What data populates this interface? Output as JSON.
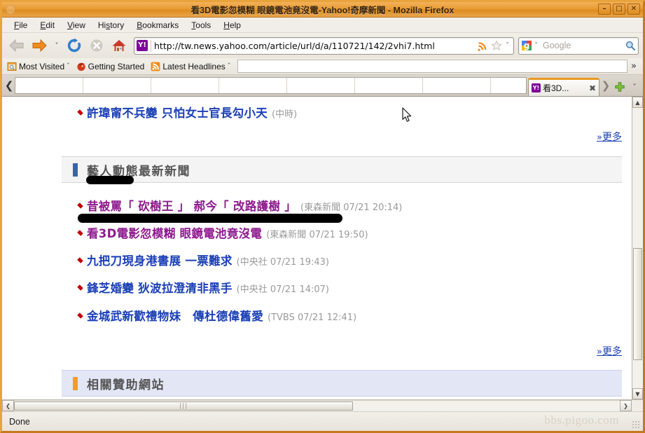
{
  "window": {
    "title": "看3D電影忽模糊 眼鏡電池竟沒電-Yahoo!奇摩新聞 - Mozilla Firefox",
    "minimize": "–",
    "maximize": "□",
    "close": "✕"
  },
  "menubar": {
    "items": [
      {
        "name": "file",
        "pre": "F",
        "mid": "ile",
        "post": ""
      },
      {
        "name": "edit",
        "pre": "E",
        "mid": "dit",
        "post": ""
      },
      {
        "name": "view",
        "pre": "V",
        "mid": "iew",
        "post": ""
      },
      {
        "name": "history",
        "pre": "Hi",
        "mid": "s",
        "post": "tory"
      },
      {
        "name": "bookmarks",
        "pre": "",
        "mid": "B",
        "post": "ookmarks"
      },
      {
        "name": "tools",
        "pre": "",
        "mid": "T",
        "post": "ools"
      },
      {
        "name": "help",
        "pre": "",
        "mid": "H",
        "post": "elp"
      }
    ],
    "labels": {
      "file": "File",
      "edit": "Edit",
      "view": "View",
      "history": "History",
      "bookmarks": "Bookmarks",
      "tools": "Tools",
      "help": "Help"
    }
  },
  "navbar": {
    "back_tooltip": "Back",
    "forward_tooltip": "Forward",
    "reload_tooltip": "Reload",
    "stop_tooltip": "Stop",
    "home_tooltip": "Home",
    "dropdown_chevron": "ˇ",
    "url": "http://tw.news.yahoo.com/article/url/d/a/110721/142/2vhi7.html",
    "favicon_label": "Y!",
    "urlbar_chevron": "ˇ"
  },
  "search": {
    "engine": "Google",
    "placeholder": "Google",
    "value": "",
    "chevron": "ˇ"
  },
  "bookmarks": {
    "items": [
      {
        "label": "Most Visited",
        "icon": "most-visited-icon",
        "chevron": "ˇ"
      },
      {
        "label": "Getting Started",
        "icon": "firefox-icon",
        "chevron": ""
      },
      {
        "label": "Latest Headlines",
        "icon": "rss-icon",
        "chevron": "ˇ"
      }
    ],
    "overflow": "»"
  },
  "tabs": {
    "scroll_left": "❮",
    "scroll_right": "❯",
    "new_tab": "+",
    "list_all": "ˇ",
    "items": [
      {
        "label": "看3D...",
        "favicon": "Y!",
        "close": "✖",
        "active": true
      }
    ]
  },
  "page": {
    "top_item": {
      "title": "許瑋甯不兵變 只怕女士官長勾小天",
      "source": "(中時)",
      "visited": false
    },
    "more_label": "更多",
    "more_prefix": "»",
    "sections": [
      {
        "name": "celebrity-news",
        "title": "藝人動態最新新聞",
        "bar_color": "#3b64a8",
        "style": "gray"
      },
      {
        "name": "sponsored-sites",
        "title": "相關贊助網站",
        "bar_color": "#f79b27",
        "style": "lav"
      }
    ],
    "news_items": [
      {
        "title": "昔被罵「 砍樹王 」 郝今「 改路護樹 」",
        "source": "(東森新聞 07/21 20:14)",
        "visited": true
      },
      {
        "title": "看3D電影忽模糊 眼鏡電池竟沒電",
        "source": "(東森新聞 07/21 19:50)",
        "visited": true
      },
      {
        "title": "九把刀現身港書展 一票難求",
        "source": "(中央社 07/21 19:43)",
        "visited": false
      },
      {
        "title": "鋒芝婚變 狄波拉澄清非黑手",
        "source": "(中央社 07/21 14:07)",
        "visited": false
      },
      {
        "title": "金城武新歡禮物妹　傳杜德偉舊愛",
        "source": "(TVBS 07/21 12:41)",
        "visited": false
      }
    ]
  },
  "scrollbars": {
    "v_up": "▲",
    "v_down": "▼",
    "h_left": "❮",
    "h_right": "❯",
    "h_grip": "|||"
  },
  "statusbar": {
    "text": "Done",
    "watermark": "bbs.pigoo.com"
  },
  "colors": {
    "titlebar": "#e89b34",
    "link_unvisited": "#1a3fb5",
    "link_visited": "#8e1a8e",
    "bullet": "#c00000",
    "section_bar_blue": "#3b64a8",
    "section_bar_orange": "#f79b27",
    "source_text": "#9a9a9a"
  }
}
